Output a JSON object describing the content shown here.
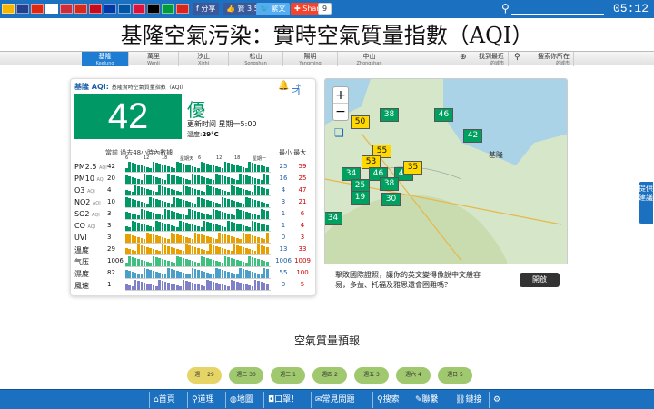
{
  "topbar": {
    "share_fb": "分享",
    "like": "贊 3,592",
    "trad": "繁文",
    "share_btn": "Share",
    "share_count": "9",
    "time": "05:12"
  },
  "title": "基隆空氣污染：實時空氣質量指數（AQI）",
  "nav": [
    {
      "cn": "基隆",
      "en": "Keelung"
    },
    {
      "cn": "萬里",
      "en": "Wanli"
    },
    {
      "cn": "汐止",
      "en": "Xizhi"
    },
    {
      "cn": "松山",
      "en": "Songshan"
    },
    {
      "cn": "陽明",
      "en": "Yangming"
    },
    {
      "cn": "中山",
      "en": "Zhongshan"
    },
    {
      "cn": "找到最近",
      "en": "的城市"
    },
    {
      "cn": "搜索你所在",
      "en": "的城市"
    }
  ],
  "card": {
    "head": "基隆 AQI:",
    "head_sub": "基隆實時空氣質量指數（AQI）",
    "aqi": "42",
    "level": "優",
    "updated": "更新时间 星期一5:00",
    "temp_label": "溫度:",
    "temp_value": "29°C",
    "hist_head": "當前 過去48小時內數據",
    "minmax_head": "最小 最大",
    "ticks": [
      "6",
      "12",
      "18",
      "星期天",
      "6",
      "12",
      "18",
      "星期一"
    ],
    "rows": [
      {
        "name": "PM2.5",
        "unit": "AQI",
        "cur": "42",
        "min": "25",
        "max": "59",
        "color": "#009966"
      },
      {
        "name": "PM10",
        "unit": "AQI",
        "cur": "20",
        "min": "16",
        "max": "25",
        "color": "#009966"
      },
      {
        "name": "O3",
        "unit": "AQI",
        "cur": "4",
        "min": "4",
        "max": "47",
        "color": "#009966"
      },
      {
        "name": "NO2",
        "unit": "AQI",
        "cur": "10",
        "min": "3",
        "max": "21",
        "color": "#009966"
      },
      {
        "name": "SO2",
        "unit": "AQI",
        "cur": "3",
        "min": "1",
        "max": "6",
        "color": "#009966"
      },
      {
        "name": "CO",
        "unit": "AQI",
        "cur": "3",
        "min": "1",
        "max": "4",
        "color": "#009966"
      },
      {
        "name": "UVI",
        "unit": "",
        "cur": "3",
        "min": "0",
        "max": "3",
        "color": "#e8a000"
      },
      {
        "name": "溫度",
        "unit": "",
        "cur": "29",
        "min": "13",
        "max": "33",
        "color": "#e8a000"
      },
      {
        "name": "气压",
        "unit": "",
        "cur": "1006",
        "min": "1006",
        "max": "1009",
        "color": "#40c080"
      },
      {
        "name": "濕度",
        "unit": "",
        "cur": "82",
        "min": "55",
        "max": "100",
        "color": "#4aa0c8"
      },
      {
        "name": "風速",
        "unit": "",
        "cur": "1",
        "min": "0",
        "max": "5",
        "color": "#8080c8"
      }
    ]
  },
  "map": {
    "markers": [
      "50",
      "38",
      "46",
      "42",
      "55",
      "53",
      "34",
      "46",
      "42",
      "25",
      "38",
      "19",
      "30",
      "35",
      "34"
    ],
    "city_label": "基隆",
    "zoom_in": "+",
    "zoom_out": "−"
  },
  "ad": {
    "text": "擊敗國際證照，讓你的英文變得像說中文般容易，多益、托福及雅思還會困難嗎？",
    "button": "開啟"
  },
  "side_tab": "提供建議",
  "forecast": {
    "title": "空氣質量預報",
    "days": [
      "週一 29",
      "週二 30",
      "週三 1",
      "週四 2",
      "週五 3",
      "週六 4",
      "週日 5"
    ]
  },
  "bottom_nav": [
    "首頁",
    "道理",
    "地圖",
    "口罩！",
    "常見問題",
    "搜索",
    "聯繫",
    "鏈接"
  ],
  "colors": {
    "primary": "#1b70c0",
    "good": "#009966",
    "moderate": "#ffd800"
  }
}
